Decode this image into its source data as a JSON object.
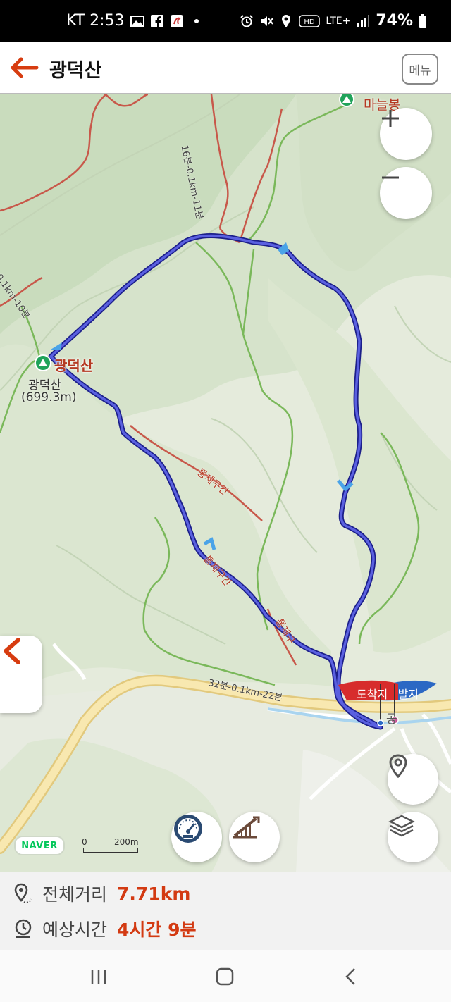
{
  "status_bar": {
    "carrier_time": "KT 2:53",
    "battery": "74%",
    "network": "LTE+",
    "icons": [
      "gallery-icon",
      "facebook-icon",
      "app-icon",
      "dot-icon",
      "alarm-icon",
      "mute-icon",
      "location-icon",
      "hd-icon",
      "signal-icon",
      "battery-icon"
    ]
  },
  "header": {
    "title": "광덕산",
    "menu_label": "메뉴"
  },
  "map": {
    "peak_name": "광덕산",
    "peak_label_line1": "광덕산",
    "peak_label_line2": "(699.3m)",
    "mountain_top_right": "마늘봉",
    "trail_label_top": "16분-0.1km-11분",
    "trail_label_left": "0.1km-10분",
    "trail_label_bottom": "32분-0.1km-22분",
    "restricted_label": "통제구간",
    "restricted_label_2": "통제구간",
    "restricted_label_3": "통제구",
    "arrival_flag": "도착지",
    "departure_flag": "출발지",
    "village_label": "공",
    "scale_zero": "0",
    "scale_distance": "200m",
    "brand": "NAVER",
    "route_color": "#3a3fc8",
    "restricted_color": "#c8584a",
    "trail_color": "#7ab85a",
    "road_color": "#f3dea0"
  },
  "summary": {
    "distance_label": "전체거리",
    "distance_value": "7.71km",
    "time_label": "예상시간",
    "time_value": "4시간 9분",
    "accent": "#d33a12"
  }
}
